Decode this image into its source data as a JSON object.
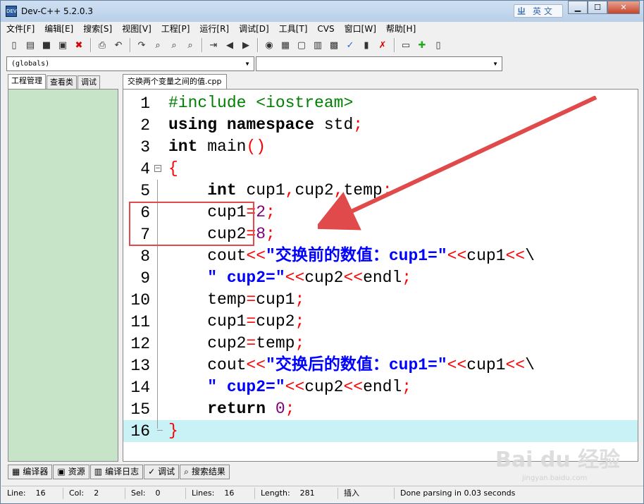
{
  "window": {
    "title": "Dev-C++ 5.2.0.3",
    "app_icon": "DEV",
    "ime_label": "英 文",
    "ime_logo": "ㄓ"
  },
  "menu": [
    "文件[F]",
    "编辑[E]",
    "搜索[S]",
    "视图[V]",
    "工程[P]",
    "运行[R]",
    "调试[D]",
    "工具[T]",
    "CVS",
    "窗口[W]",
    "帮助[H]"
  ],
  "toolbar_icons": [
    "new-file-icon",
    "open-icon",
    "save-icon",
    "save-all-icon",
    "close-file-icon",
    "print-icon",
    "undo-icon",
    "redo-icon",
    "find-icon",
    "replace-icon",
    "find-next-icon",
    "goto-line-icon",
    "back-icon",
    "forward-icon",
    "toggle-bookmark-icon",
    "compile-icon",
    "run-icon",
    "compile-run-icon",
    "rebuild-icon",
    "check-syntax-icon",
    "chart-icon",
    "stop-icon",
    "new-project-icon",
    "add-file-icon",
    "project-options-icon"
  ],
  "combos": {
    "scope": "(globals)",
    "function": ""
  },
  "left_tabs": [
    "工程管理",
    "查看类",
    "调试"
  ],
  "file_tab": "交换两个变量之间的值.cpp",
  "code_lines": [
    {
      "n": "1",
      "html": "<span class='pp'>#include &lt;iostream&gt;</span>"
    },
    {
      "n": "2",
      "html": "<span class='kw'>using</span> <span class='kw'>namespace</span> std<span class='op'>;</span>"
    },
    {
      "n": "3",
      "html": "<span class='kw'>int</span> main<span class='op'>()</span>"
    },
    {
      "n": "4",
      "html": "<span class='op'>{</span>"
    },
    {
      "n": "5",
      "html": "    <span class='kw'>int</span> cup1<span class='op'>,</span>cup2<span class='op'>,</span>temp<span class='op'>;</span>"
    },
    {
      "n": "6",
      "html": "    cup1<span class='op'>=</span><span class='num'>2</span><span class='op'>;</span>"
    },
    {
      "n": "7",
      "html": "    cup2<span class='op'>=</span><span class='num'>8</span><span class='op'>;</span>"
    },
    {
      "n": "8",
      "html": "    cout<span class='op'>&lt;&lt;</span><span class='str'>\"交换前的数值：cup1=\"</span><span class='op'>&lt;&lt;</span>cup1<span class='op'>&lt;&lt;</span>\\"
    },
    {
      "n": "9",
      "html": "    <span class='str'>\" cup2=\"</span><span class='op'>&lt;&lt;</span>cup2<span class='op'>&lt;&lt;</span>endl<span class='op'>;</span>"
    },
    {
      "n": "10",
      "html": "    temp<span class='op'>=</span>cup1<span class='op'>;</span>"
    },
    {
      "n": "11",
      "html": "    cup1<span class='op'>=</span>cup2<span class='op'>;</span>"
    },
    {
      "n": "12",
      "html": "    cup2<span class='op'>=</span>temp<span class='op'>;</span>"
    },
    {
      "n": "13",
      "html": "    cout<span class='op'>&lt;&lt;</span><span class='str'>\"交换后的数值：cup1=\"</span><span class='op'>&lt;&lt;</span>cup1<span class='op'>&lt;&lt;</span>\\"
    },
    {
      "n": "14",
      "html": "    <span class='str'>\" cup2=\"</span><span class='op'>&lt;&lt;</span>cup2<span class='op'>&lt;&lt;</span>endl<span class='op'>;</span>"
    },
    {
      "n": "15",
      "html": "    <span class='kw'>return</span> <span class='num'>0</span><span class='op'>;</span>"
    },
    {
      "n": "16",
      "html": "<span class='op'>}</span>"
    }
  ],
  "current_line": 16,
  "bottom_tabs": [
    {
      "icon": "compiler-icon",
      "glyph": "▦",
      "label": "编译器"
    },
    {
      "icon": "resources-icon",
      "glyph": "▣",
      "label": "资源"
    },
    {
      "icon": "compile-log-icon",
      "glyph": "▥",
      "label": "编译日志"
    },
    {
      "icon": "debug-icon",
      "glyph": "✓",
      "label": "调试"
    },
    {
      "icon": "search-results-icon",
      "glyph": "⌕",
      "label": "搜索结果"
    }
  ],
  "status": {
    "line_label": "Line:",
    "line_value": "16",
    "col_label": "Col:",
    "col_value": "2",
    "sel_label": "Sel:",
    "sel_value": "0",
    "lines_label": "Lines:",
    "lines_value": "16",
    "length_label": "Length:",
    "length_value": "281",
    "mode": "插入",
    "message": "Done parsing in 0.03 seconds"
  },
  "watermark": {
    "text": "Bai du 经验",
    "sub": "jingyan.baidu.com"
  },
  "colors": {
    "accent": "#e04a4a",
    "current_line": "#c9f2f6",
    "panel": "#c8e4c8"
  }
}
